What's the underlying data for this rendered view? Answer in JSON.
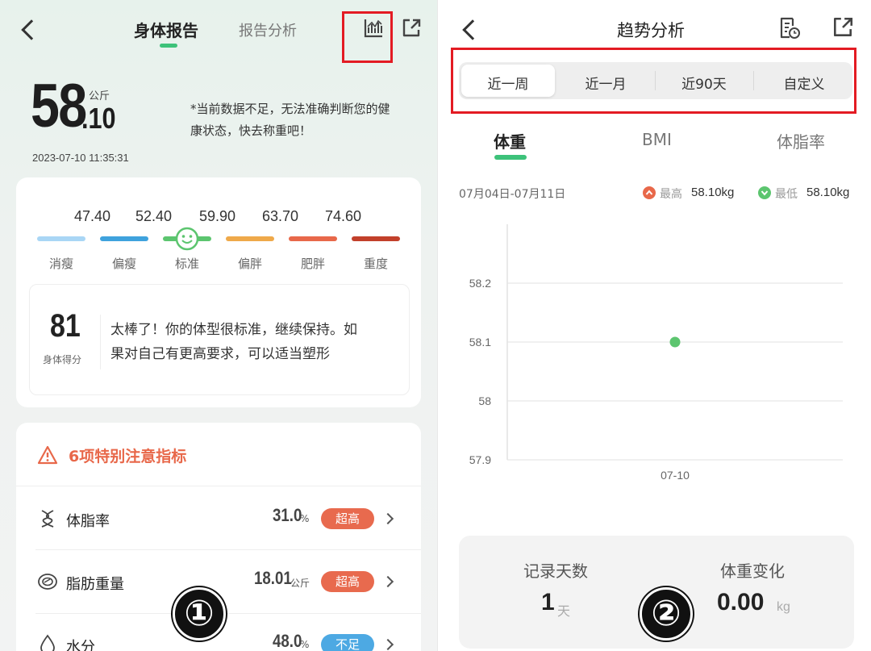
{
  "left": {
    "tabs": [
      {
        "label": "身体报告",
        "active": true
      },
      {
        "label": "报告分析",
        "active": false
      }
    ],
    "weight": {
      "integer": "58",
      "decimal": ".10",
      "unit": "公斤"
    },
    "notice": "*当前数据不足，无法准确判断您的健康状态，快去称重吧！",
    "notice_line1": "*当前数据不足，无法准确判断您的健",
    "notice_line2": "康状态，快去称重吧！",
    "timestamp": "2023-07-10 11:35:31",
    "range_values": [
      "47.40",
      "52.40",
      "59.90",
      "63.70",
      "74.60"
    ],
    "range_labels": [
      "消瘦",
      "偏瘦",
      "标准",
      "偏胖",
      "肥胖",
      "重度"
    ],
    "range_colors": [
      "#a9d6f5",
      "#3fa2dd",
      "#5cc56f",
      "#efa94a",
      "#e8684a",
      "#c2402b"
    ],
    "score": {
      "value": "81",
      "label": "身体得分",
      "text_line1": "太棒了！你的体型很标准，继续保持。如",
      "text_line2": "果对自己有更高要求，可以适当塑形"
    },
    "attention": {
      "title": "6项特别注意指标",
      "items": [
        {
          "icon": "dna-icon",
          "name": "体脂率",
          "value": "31.0",
          "unit": "%",
          "status": "超高",
          "status_type": "high"
        },
        {
          "icon": "fat-mass-icon",
          "name": "脂肪重量",
          "value": "18.01",
          "unit": "公斤",
          "status": "超高",
          "status_type": "high"
        },
        {
          "icon": "water-drop-icon",
          "name": "水分",
          "value": "48.0",
          "unit": "%",
          "status": "不足",
          "status_type": "low"
        }
      ]
    },
    "badge": "①"
  },
  "right": {
    "title": "趋势分析",
    "segments": [
      {
        "label": "近一周",
        "active": true
      },
      {
        "label": "近一月",
        "active": false
      },
      {
        "label": "近90天",
        "active": false
      },
      {
        "label": "自定义",
        "active": false
      }
    ],
    "metric_tabs": [
      {
        "label": "体重",
        "active": true
      },
      {
        "label": "BMI",
        "active": false
      },
      {
        "label": "体脂率",
        "active": false
      }
    ],
    "date_range": "07月04日-07月11日",
    "max_label": "最高",
    "max_value": "58.10kg",
    "min_label": "最低",
    "min_value": "58.10kg",
    "stats": {
      "days_label": "记录天数",
      "days_value": "1",
      "days_unit": "天",
      "change_label": "体重变化",
      "change_value": "0.00",
      "change_unit": "kg"
    },
    "badge": "②"
  },
  "colors": {
    "accent": "#3dc27a",
    "high": "#e86a4e",
    "low": "#4da9e3",
    "highlight_box": "#e31b23"
  },
  "chart_data": {
    "type": "scatter",
    "x": [
      "07-10"
    ],
    "series": [
      {
        "values": [
          58.1
        ]
      }
    ],
    "y_ticks": [
      57.9,
      58,
      58.1,
      58.2
    ],
    "y_tick_labels": [
      "57.9",
      "58",
      "58.1",
      "58.2"
    ],
    "x_tick_labels": [
      "07-10"
    ],
    "ylim": [
      57.9,
      58.2
    ],
    "grid": true,
    "point_color": "#5cc56f"
  }
}
